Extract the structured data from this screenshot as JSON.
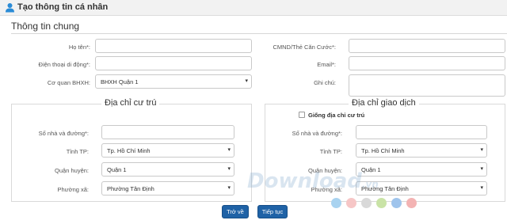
{
  "header": {
    "title": "Tạo thông tin cá nhân",
    "icon": "user-icon"
  },
  "general": {
    "title": "Thông tin chung",
    "fullname_label": "Họ tên*:",
    "fullname_value": "",
    "idcard_label": "CMND/Thẻ Căn Cước*:",
    "idcard_value": "",
    "phone_label": "Điện thoại di động*:",
    "phone_value": "",
    "email_label": "Email*:",
    "email_value": "",
    "agency_label": "Cơ quan BHXH:",
    "agency_value": "BHXH Quận 1",
    "note_label": "Ghi chú:",
    "note_value": ""
  },
  "residence": {
    "legend": "Địa chỉ cư trú",
    "street_label": "Số nhà và đường*:",
    "street_value": "",
    "province_label": "Tỉnh TP:",
    "province_value": "Tp. Hồ Chí Minh",
    "district_label": "Quận huyện:",
    "district_value": "Quận 1",
    "ward_label": "Phường xã:",
    "ward_value": "Phường Tân Định"
  },
  "transaction": {
    "legend": "Địa chỉ giao dịch",
    "same_checkbox_label": "Giống địa chỉ cư trú",
    "same_checked": false,
    "street_label": "Số nhà và đường*:",
    "street_value": "",
    "province_label": "Tỉnh TP:",
    "province_value": "Tp. Hồ Chí Minh",
    "district_label": "Quận huyện:",
    "district_value": "Quận 1",
    "ward_label": "Phường xã:",
    "ward_value": "Phường Tân Định"
  },
  "actions": {
    "back_label": "Trở về",
    "continue_label": "Tiếp tục"
  },
  "watermark": {
    "text": "Download",
    "suffix": ".vn",
    "dot_colors": [
      "#a9d3f0",
      "#f6c6c6",
      "#d9d9d9",
      "#c9e3a6",
      "#9fc4ec",
      "#f3b3b3"
    ]
  },
  "colors": {
    "button_bg": "#1f62a6",
    "header_icon": "#2a8bd6"
  },
  "caret_glyph": "▾"
}
